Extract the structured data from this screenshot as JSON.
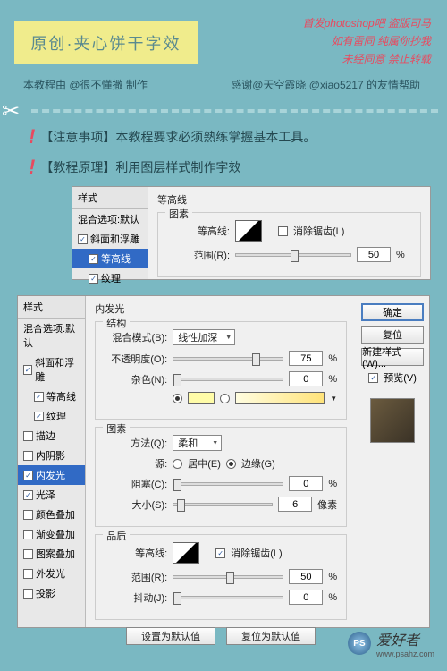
{
  "header": {
    "title": "原创·夹心饼干字效"
  },
  "notices": {
    "line1": "首发photoshop吧 盗版司马",
    "line2": "如有雷同 纯属你抄我",
    "line3": "未经同意 禁止转载"
  },
  "credits": "本教程由 @很不懂撒 制作",
  "thanks": "感谢@天空霞晓 @xiao5217 的友情帮助",
  "bullets": {
    "b1": "【注意事项】本教程要求必须熟练掌握基本工具。",
    "b2": "【教程原理】利用图层样式制作字效"
  },
  "panel1": {
    "sidebar_hd": "样式",
    "blend_opts": "混合选项:默认",
    "bevel": "斜面和浮雕",
    "contour_side": "等高线",
    "texture": "纹理",
    "group": "等高线",
    "section": "图素",
    "contour_lab": "等高线:",
    "anti_alias": "消除锯齿(L)",
    "range_lab": "范围(R):",
    "range_val": "50",
    "pct": "%"
  },
  "panel2": {
    "sidebar_hd": "样式",
    "blend_opts": "混合选项:默认",
    "items": {
      "bevel": "斜面和浮雕",
      "contour": "等高线",
      "texture": "纹理",
      "stroke": "描边",
      "inner_shadow": "内阴影",
      "inner_glow": "内发光",
      "satin": "光泽",
      "color_overlay": "颜色叠加",
      "gradient_overlay": "渐变叠加",
      "pattern_overlay": "图案叠加",
      "outer_glow": "外发光",
      "drop_shadow": "投影"
    },
    "title": "内发光",
    "struct": "结构",
    "blend_mode_lab": "混合模式(B):",
    "blend_mode_val": "线性加深",
    "opacity_lab": "不透明度(O):",
    "opacity_val": "75",
    "noise_lab": "杂色(N):",
    "noise_val": "0",
    "elements": "图素",
    "technique_lab": "方法(Q):",
    "technique_val": "柔和",
    "source_lab": "源:",
    "source_center": "居中(E)",
    "source_edge": "边缘(G)",
    "choke_lab": "阻塞(C):",
    "choke_val": "0",
    "size_lab": "大小(S):",
    "size_val": "6",
    "px": "像素",
    "quality": "品质",
    "contour_lab": "等高线:",
    "anti_alias": "消除锯齿(L)",
    "range_lab": "范围(R):",
    "range_val": "50",
    "jitter_lab": "抖动(J):",
    "jitter_val": "0",
    "pct": "%",
    "set_default": "设置为默认值",
    "reset_default": "复位为默认值",
    "btn_ok": "确定",
    "btn_reset": "复位",
    "btn_new_style": "新建样式(W)...",
    "preview": "预览(V)"
  },
  "watermark": {
    "logo": "PS",
    "text": "爱好者",
    "sub": "www.psahz.com"
  }
}
